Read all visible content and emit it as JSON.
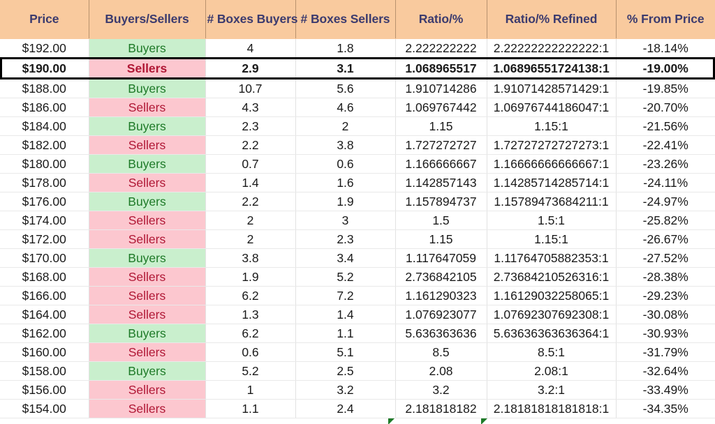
{
  "table": {
    "columns": [
      "Price",
      "Buyers/Sellers",
      "# Boxes Buyers",
      "# Boxes Sellers",
      "Ratio/%",
      "Ratio/% Refined",
      "% From Price"
    ],
    "colors": {
      "header_bg": "#F9CA9E",
      "header_text": "#3C3B6E",
      "buyers_bg": "#C9EFCD",
      "buyers_text": "#1E7A28",
      "sellers_bg": "#FCC7CF",
      "sellers_text": "#B01735",
      "focus_border": "#000000",
      "cell_text": "#1A1A1A"
    },
    "rows": [
      {
        "price": "$192.00",
        "side": "Buyers",
        "boxes_buyers": "4",
        "boxes_sellers": "1.8",
        "ratio": "2.222222222",
        "ratio_refined": "2.22222222222222:1",
        "from_price": "-18.14%",
        "focus": false
      },
      {
        "price": "$190.00",
        "side": "Sellers",
        "boxes_buyers": "2.9",
        "boxes_sellers": "3.1",
        "ratio": "1.068965517",
        "ratio_refined": "1.06896551724138:1",
        "from_price": "-19.00%",
        "focus": true
      },
      {
        "price": "$188.00",
        "side": "Buyers",
        "boxes_buyers": "10.7",
        "boxes_sellers": "5.6",
        "ratio": "1.910714286",
        "ratio_refined": "1.91071428571429:1",
        "from_price": "-19.85%",
        "focus": false
      },
      {
        "price": "$186.00",
        "side": "Sellers",
        "boxes_buyers": "4.3",
        "boxes_sellers": "4.6",
        "ratio": "1.069767442",
        "ratio_refined": "1.06976744186047:1",
        "from_price": "-20.70%",
        "focus": false
      },
      {
        "price": "$184.00",
        "side": "Buyers",
        "boxes_buyers": "2.3",
        "boxes_sellers": "2",
        "ratio": "1.15",
        "ratio_refined": "1.15:1",
        "from_price": "-21.56%",
        "focus": false
      },
      {
        "price": "$182.00",
        "side": "Sellers",
        "boxes_buyers": "2.2",
        "boxes_sellers": "3.8",
        "ratio": "1.727272727",
        "ratio_refined": "1.72727272727273:1",
        "from_price": "-22.41%",
        "focus": false
      },
      {
        "price": "$180.00",
        "side": "Buyers",
        "boxes_buyers": "0.7",
        "boxes_sellers": "0.6",
        "ratio": "1.166666667",
        "ratio_refined": "1.16666666666667:1",
        "from_price": "-23.26%",
        "focus": false
      },
      {
        "price": "$178.00",
        "side": "Sellers",
        "boxes_buyers": "1.4",
        "boxes_sellers": "1.6",
        "ratio": "1.142857143",
        "ratio_refined": "1.14285714285714:1",
        "from_price": "-24.11%",
        "focus": false
      },
      {
        "price": "$176.00",
        "side": "Buyers",
        "boxes_buyers": "2.2",
        "boxes_sellers": "1.9",
        "ratio": "1.157894737",
        "ratio_refined": "1.15789473684211:1",
        "from_price": "-24.97%",
        "focus": false
      },
      {
        "price": "$174.00",
        "side": "Sellers",
        "boxes_buyers": "2",
        "boxes_sellers": "3",
        "ratio": "1.5",
        "ratio_refined": "1.5:1",
        "from_price": "-25.82%",
        "focus": false
      },
      {
        "price": "$172.00",
        "side": "Sellers",
        "boxes_buyers": "2",
        "boxes_sellers": "2.3",
        "ratio": "1.15",
        "ratio_refined": "1.15:1",
        "from_price": "-26.67%",
        "focus": false
      },
      {
        "price": "$170.00",
        "side": "Buyers",
        "boxes_buyers": "3.8",
        "boxes_sellers": "3.4",
        "ratio": "1.117647059",
        "ratio_refined": "1.11764705882353:1",
        "from_price": "-27.52%",
        "focus": false
      },
      {
        "price": "$168.00",
        "side": "Sellers",
        "boxes_buyers": "1.9",
        "boxes_sellers": "5.2",
        "ratio": "2.736842105",
        "ratio_refined": "2.73684210526316:1",
        "from_price": "-28.38%",
        "focus": false
      },
      {
        "price": "$166.00",
        "side": "Sellers",
        "boxes_buyers": "6.2",
        "boxes_sellers": "7.2",
        "ratio": "1.161290323",
        "ratio_refined": "1.16129032258065:1",
        "from_price": "-29.23%",
        "focus": false
      },
      {
        "price": "$164.00",
        "side": "Sellers",
        "boxes_buyers": "1.3",
        "boxes_sellers": "1.4",
        "ratio": "1.076923077",
        "ratio_refined": "1.07692307692308:1",
        "from_price": "-30.08%",
        "focus": false
      },
      {
        "price": "$162.00",
        "side": "Buyers",
        "boxes_buyers": "6.2",
        "boxes_sellers": "1.1",
        "ratio": "5.636363636",
        "ratio_refined": "5.63636363636364:1",
        "from_price": "-30.93%",
        "focus": false
      },
      {
        "price": "$160.00",
        "side": "Sellers",
        "boxes_buyers": "0.6",
        "boxes_sellers": "5.1",
        "ratio": "8.5",
        "ratio_refined": "8.5:1",
        "from_price": "-31.79%",
        "focus": false
      },
      {
        "price": "$158.00",
        "side": "Buyers",
        "boxes_buyers": "5.2",
        "boxes_sellers": "2.5",
        "ratio": "2.08",
        "ratio_refined": "2.08:1",
        "from_price": "-32.64%",
        "focus": false
      },
      {
        "price": "$156.00",
        "side": "Sellers",
        "boxes_buyers": "1",
        "boxes_sellers": "3.2",
        "ratio": "3.2",
        "ratio_refined": "3.2:1",
        "from_price": "-33.49%",
        "focus": false
      },
      {
        "price": "$154.00",
        "side": "Sellers",
        "boxes_buyers": "1.1",
        "boxes_sellers": "2.4",
        "ratio": "2.181818182",
        "ratio_refined": "2.18181818181818:1",
        "from_price": "-34.35%",
        "focus": false
      }
    ]
  }
}
